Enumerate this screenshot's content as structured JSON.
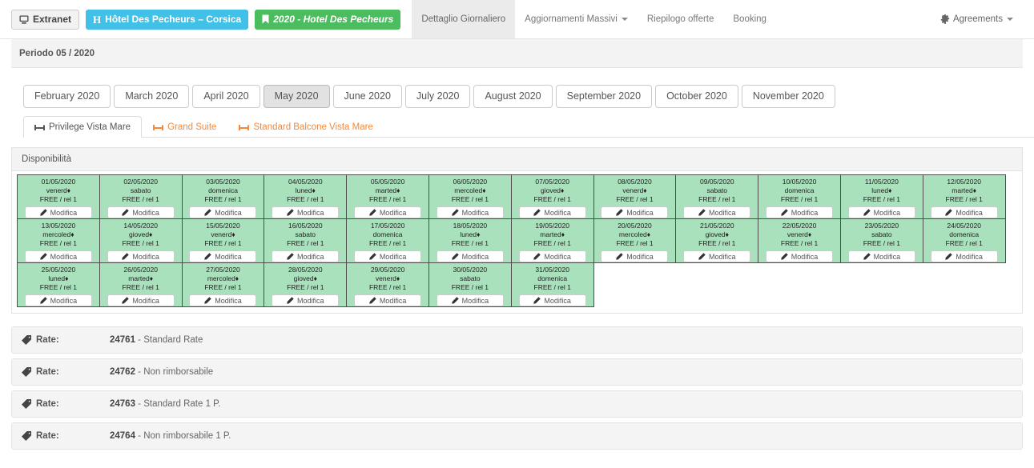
{
  "navbar": {
    "extranet_label": "Extranet",
    "extranet_icon": "desktop-icon",
    "hotel_badge": {
      "icon": "h-letter-icon",
      "label": "Hôtel Des Pecheurs – Corsica",
      "color": "#41c1e8"
    },
    "year_badge": {
      "icon": "bookmark-icon",
      "label": "2020 - Hotel Des Pecheurs",
      "color": "#4bbd5e"
    },
    "menu": [
      {
        "label": "Dettaglio Giornaliero",
        "active": true,
        "caret": false
      },
      {
        "label": "Aggiornamenti Massivi",
        "active": false,
        "caret": true
      },
      {
        "label": "Riepilogo offerte",
        "active": false,
        "caret": false
      },
      {
        "label": "Booking",
        "active": false,
        "caret": false
      }
    ],
    "right": {
      "icon": "gear-icon",
      "label": "Agreements",
      "caret": true
    }
  },
  "period": {
    "label": "Periodo 05 / 2020"
  },
  "months": [
    {
      "label": "February 2020",
      "active": false
    },
    {
      "label": "March 2020",
      "active": false
    },
    {
      "label": "April 2020",
      "active": false
    },
    {
      "label": "May 2020",
      "active": true
    },
    {
      "label": "June 2020",
      "active": false
    },
    {
      "label": "July 2020",
      "active": false
    },
    {
      "label": "August 2020",
      "active": false
    },
    {
      "label": "September 2020",
      "active": false
    },
    {
      "label": "October 2020",
      "active": false
    },
    {
      "label": "November 2020",
      "active": false
    }
  ],
  "room_tabs": [
    {
      "label": "Privilege Vista Mare",
      "icon": "bed-icon",
      "active": true
    },
    {
      "label": "Grand Suite",
      "icon": "bed-icon",
      "active": false
    },
    {
      "label": "Standard Balcone Vista Mare",
      "icon": "bed-icon",
      "active": false
    }
  ],
  "availability": {
    "title": "Disponibilità",
    "cell_color": "#a8e1bc",
    "edit_label": "Modifica",
    "edit_icon": "pencil-icon",
    "days": [
      {
        "date": "01/05/2020",
        "weekday": "venerd♦",
        "status": "FREE / rel 1"
      },
      {
        "date": "02/05/2020",
        "weekday": "sabato",
        "status": "FREE / rel 1"
      },
      {
        "date": "03/05/2020",
        "weekday": "domenica",
        "status": "FREE / rel 1"
      },
      {
        "date": "04/05/2020",
        "weekday": "luned♦",
        "status": "FREE / rel 1"
      },
      {
        "date": "05/05/2020",
        "weekday": "marted♦",
        "status": "FREE / rel 1"
      },
      {
        "date": "06/05/2020",
        "weekday": "mercoled♦",
        "status": "FREE / rel 1"
      },
      {
        "date": "07/05/2020",
        "weekday": "gioved♦",
        "status": "FREE / rel 1"
      },
      {
        "date": "08/05/2020",
        "weekday": "venerd♦",
        "status": "FREE / rel 1"
      },
      {
        "date": "09/05/2020",
        "weekday": "sabato",
        "status": "FREE / rel 1"
      },
      {
        "date": "10/05/2020",
        "weekday": "domenica",
        "status": "FREE / rel 1"
      },
      {
        "date": "11/05/2020",
        "weekday": "luned♦",
        "status": "FREE / rel 1"
      },
      {
        "date": "12/05/2020",
        "weekday": "marted♦",
        "status": "FREE / rel 1"
      },
      {
        "date": "13/05/2020",
        "weekday": "mercoled♦",
        "status": "FREE / rel 1"
      },
      {
        "date": "14/05/2020",
        "weekday": "gioved♦",
        "status": "FREE / rel 1"
      },
      {
        "date": "15/05/2020",
        "weekday": "venerd♦",
        "status": "FREE / rel 1"
      },
      {
        "date": "16/05/2020",
        "weekday": "sabato",
        "status": "FREE / rel 1"
      },
      {
        "date": "17/05/2020",
        "weekday": "domenica",
        "status": "FREE / rel 1"
      },
      {
        "date": "18/05/2020",
        "weekday": "luned♦",
        "status": "FREE / rel 1"
      },
      {
        "date": "19/05/2020",
        "weekday": "marted♦",
        "status": "FREE / rel 1"
      },
      {
        "date": "20/05/2020",
        "weekday": "mercoled♦",
        "status": "FREE / rel 1"
      },
      {
        "date": "21/05/2020",
        "weekday": "gioved♦",
        "status": "FREE / rel 1"
      },
      {
        "date": "22/05/2020",
        "weekday": "venerd♦",
        "status": "FREE / rel 1"
      },
      {
        "date": "23/05/2020",
        "weekday": "sabato",
        "status": "FREE / rel 1"
      },
      {
        "date": "24/05/2020",
        "weekday": "domenica",
        "status": "FREE / rel 1"
      },
      {
        "date": "25/05/2020",
        "weekday": "luned♦",
        "status": "FREE / rel 1"
      },
      {
        "date": "26/05/2020",
        "weekday": "marted♦",
        "status": "FREE / rel 1"
      },
      {
        "date": "27/05/2020",
        "weekday": "mercoled♦",
        "status": "FREE / rel 1"
      },
      {
        "date": "28/05/2020",
        "weekday": "gioved♦",
        "status": "FREE / rel 1"
      },
      {
        "date": "29/05/2020",
        "weekday": "venerd♦",
        "status": "FREE / rel 1"
      },
      {
        "date": "30/05/2020",
        "weekday": "sabato",
        "status": "FREE / rel 1"
      },
      {
        "date": "31/05/2020",
        "weekday": "domenica",
        "status": "FREE / rel 1"
      }
    ]
  },
  "rates": {
    "label": "Rate:",
    "icon": "tag-icon",
    "items": [
      {
        "code": "24761",
        "sep": " - ",
        "name": "Standard Rate"
      },
      {
        "code": "24762",
        "sep": " - ",
        "name": "Non rimborsabile"
      },
      {
        "code": "24763",
        "sep": " - ",
        "name": "Standard Rate 1 P."
      },
      {
        "code": "24764",
        "sep": " - ",
        "name": "Non rimborsabile 1 P."
      }
    ]
  }
}
